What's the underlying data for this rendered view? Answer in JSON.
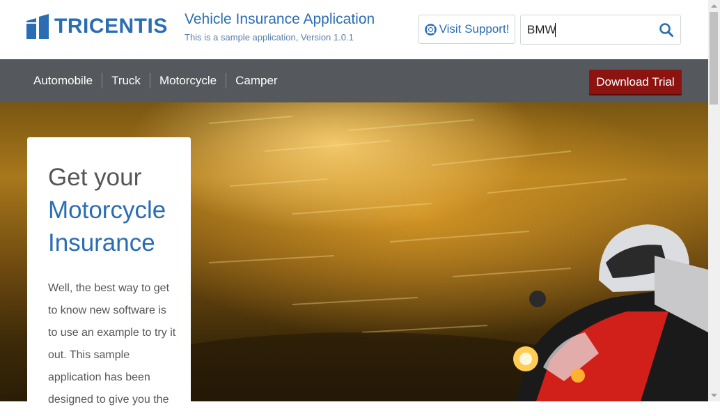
{
  "header": {
    "logo_text": "TRICENTIS",
    "title": "Vehicle Insurance Application",
    "subtitle": "This is a sample application, Version 1.0.1",
    "support_label": "Visit Support!",
    "search_value": "BMW"
  },
  "nav": {
    "items": [
      {
        "label": "Automobile"
      },
      {
        "label": "Truck"
      },
      {
        "label": "Motorcycle"
      },
      {
        "label": "Camper"
      }
    ],
    "trial_label": "Download Trial"
  },
  "hero": {
    "heading_line1": "Get your",
    "heading_line2": "Motorcycle",
    "heading_line3": "Insurance",
    "body_text": "Well, the best way to get to know new software is to use an example to try it out. This sample application has been designed to give you the"
  },
  "colors": {
    "brand_blue": "#2a6db3",
    "nav_bg": "#55595d",
    "trial_bg": "#8b1410"
  },
  "icons": {
    "support": "lifebuoy-icon",
    "search": "search-icon",
    "logo": "tricentis-logo-icon"
  }
}
